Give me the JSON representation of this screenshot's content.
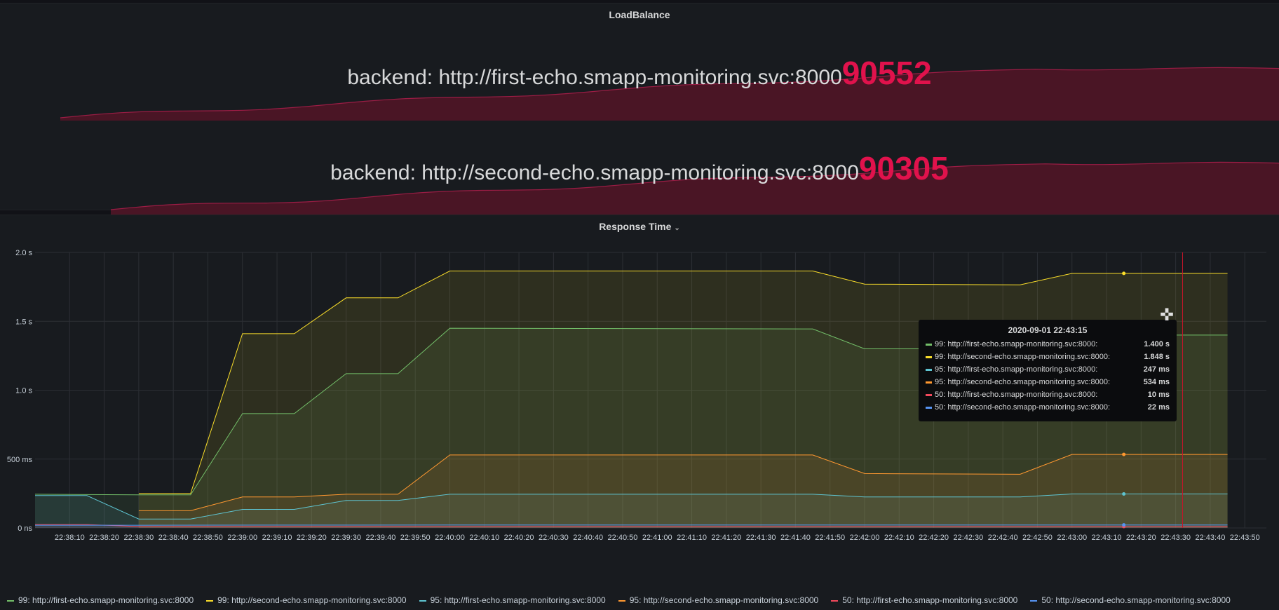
{
  "loadbalance": {
    "title": "LoadBalance",
    "stats": [
      {
        "label": "backend: http://first-echo.smapp-monitoring.svc:8000",
        "value": "90552"
      },
      {
        "label": "backend: http://second-echo.smapp-monitoring.svc:8000",
        "value": "90305"
      }
    ],
    "colors": {
      "value": "#e0124c",
      "spark_fill": "#4a1525",
      "spark_line": "#9b1d45"
    }
  },
  "response_time": {
    "title": "Response Time",
    "caret_icon": "chevron-down-icon",
    "tooltip": {
      "time": "2020-09-01 22:43:15",
      "rows": [
        {
          "name": "99: http://first-echo.smapp-monitoring.svc:8000:",
          "value": "1.400 s",
          "color": "#73bf69"
        },
        {
          "name": "99: http://second-echo.smapp-monitoring.svc:8000:",
          "value": "1.848 s",
          "color": "#fade2a"
        },
        {
          "name": "95: http://first-echo.smapp-monitoring.svc:8000:",
          "value": "247 ms",
          "color": "#5ec4d1"
        },
        {
          "name": "95: http://second-echo.smapp-monitoring.svc:8000:",
          "value": "534 ms",
          "color": "#ff9830"
        },
        {
          "name": "50: http://first-echo.smapp-monitoring.svc:8000:",
          "value": "10 ms",
          "color": "#f2495c"
        },
        {
          "name": "50: http://second-echo.smapp-monitoring.svc:8000:",
          "value": "22 ms",
          "color": "#5794f2"
        }
      ]
    },
    "legend": [
      {
        "name": "99: http://first-echo.smapp-monitoring.svc:8000",
        "color": "#73bf69"
      },
      {
        "name": "99: http://second-echo.smapp-monitoring.svc:8000",
        "color": "#fade2a"
      },
      {
        "name": "95: http://first-echo.smapp-monitoring.svc:8000",
        "color": "#5ec4d1"
      },
      {
        "name": "95: http://second-echo.smapp-monitoring.svc:8000",
        "color": "#ff9830"
      },
      {
        "name": "50: http://first-echo.smapp-monitoring.svc:8000",
        "color": "#f2495c"
      },
      {
        "name": "50: http://second-echo.smapp-monitoring.svc:8000",
        "color": "#5794f2"
      }
    ]
  },
  "chart_data": {
    "type": "area",
    "y_ticks": [
      "0 ns",
      "500 ms",
      "1.0 s",
      "1.5 s",
      "2.0 s"
    ],
    "ylim": [
      0,
      2000
    ],
    "y_unit": "ms",
    "x_ticks": [
      "22:38:10",
      "22:38:20",
      "22:38:30",
      "22:38:40",
      "22:38:50",
      "22:39:00",
      "22:39:10",
      "22:39:20",
      "22:39:30",
      "22:39:40",
      "22:39:50",
      "22:40:00",
      "22:40:10",
      "22:40:20",
      "22:40:30",
      "22:40:40",
      "22:40:50",
      "22:41:00",
      "22:41:10",
      "22:41:20",
      "22:41:30",
      "22:41:40",
      "22:41:50",
      "22:42:00",
      "22:42:10",
      "22:42:20",
      "22:42:30",
      "22:42:40",
      "22:42:50",
      "22:43:00",
      "22:43:10",
      "22:43:20",
      "22:43:30",
      "22:43:40",
      "22:43:50"
    ],
    "x_range": [
      "22:38:00",
      "22:43:53"
    ],
    "cursor_time": "22:43:32",
    "grid": true,
    "legend_position": "bottom",
    "series": [
      {
        "name": "99: http://first-echo.smapp-monitoring.svc:8000",
        "color": "#73bf69",
        "points": [
          [
            "22:38:00",
            245
          ],
          [
            "22:38:30",
            240
          ],
          [
            "22:38:45",
            240
          ],
          [
            "22:39:00",
            830
          ],
          [
            "22:39:15",
            830
          ],
          [
            "22:39:30",
            1120
          ],
          [
            "22:39:45",
            1120
          ],
          [
            "22:40:00",
            1450
          ],
          [
            "22:41:45",
            1445
          ],
          [
            "22:42:00",
            1300
          ],
          [
            "22:42:45",
            1300
          ],
          [
            "22:43:00",
            1400
          ],
          [
            "22:43:45",
            1400
          ]
        ]
      },
      {
        "name": "99: http://second-echo.smapp-monitoring.svc:8000",
        "color": "#fade2a",
        "points": [
          [
            "22:38:30",
            250
          ],
          [
            "22:38:45",
            250
          ],
          [
            "22:39:00",
            1410
          ],
          [
            "22:39:15",
            1410
          ],
          [
            "22:39:30",
            1670
          ],
          [
            "22:39:45",
            1670
          ],
          [
            "22:40:00",
            1865
          ],
          [
            "22:41:45",
            1865
          ],
          [
            "22:42:00",
            1770
          ],
          [
            "22:42:45",
            1765
          ],
          [
            "22:43:00",
            1848
          ],
          [
            "22:43:45",
            1848
          ]
        ]
      },
      {
        "name": "95: http://first-echo.smapp-monitoring.svc:8000",
        "color": "#5ec4d1",
        "points": [
          [
            "22:38:00",
            235
          ],
          [
            "22:38:15",
            235
          ],
          [
            "22:38:30",
            65
          ],
          [
            "22:38:45",
            65
          ],
          [
            "22:39:00",
            135
          ],
          [
            "22:39:15",
            135
          ],
          [
            "22:39:30",
            200
          ],
          [
            "22:39:45",
            200
          ],
          [
            "22:40:00",
            245
          ],
          [
            "22:41:45",
            245
          ],
          [
            "22:42:00",
            225
          ],
          [
            "22:42:45",
            225
          ],
          [
            "22:43:00",
            247
          ],
          [
            "22:43:45",
            247
          ]
        ]
      },
      {
        "name": "95: http://second-echo.smapp-monitoring.svc:8000",
        "color": "#ff9830",
        "points": [
          [
            "22:38:30",
            125
          ],
          [
            "22:38:45",
            125
          ],
          [
            "22:39:00",
            225
          ],
          [
            "22:39:15",
            225
          ],
          [
            "22:39:30",
            245
          ],
          [
            "22:39:45",
            245
          ],
          [
            "22:40:00",
            530
          ],
          [
            "22:41:45",
            530
          ],
          [
            "22:42:00",
            395
          ],
          [
            "22:42:45",
            390
          ],
          [
            "22:43:00",
            534
          ],
          [
            "22:43:45",
            534
          ]
        ]
      },
      {
        "name": "50: http://first-echo.smapp-monitoring.svc:8000",
        "color": "#f2495c",
        "points": [
          [
            "22:38:00",
            25
          ],
          [
            "22:38:15",
            25
          ],
          [
            "22:38:30",
            10
          ],
          [
            "22:43:45",
            10
          ]
        ]
      },
      {
        "name": "50: http://second-echo.smapp-monitoring.svc:8000",
        "color": "#5794f2",
        "points": [
          [
            "22:38:00",
            20
          ],
          [
            "22:38:30",
            20
          ],
          [
            "22:40:00",
            22
          ],
          [
            "22:43:45",
            22
          ]
        ]
      }
    ]
  }
}
